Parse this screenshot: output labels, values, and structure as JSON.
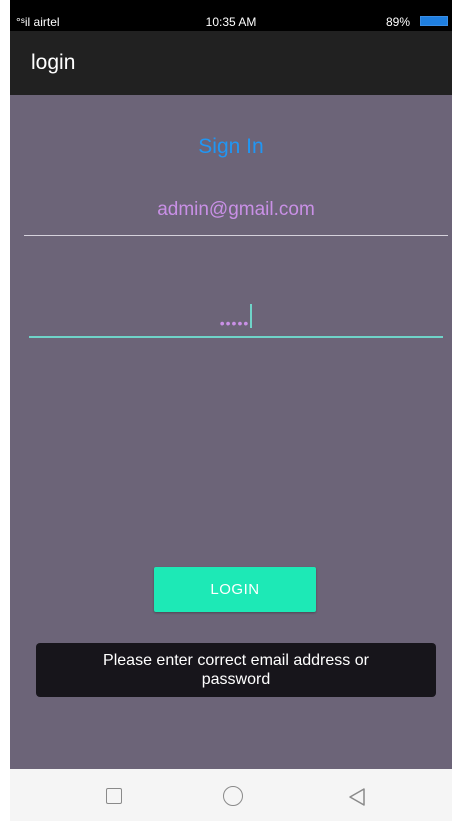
{
  "status_bar": {
    "carrier": "°ˢil airtel",
    "time": "10:35 AM",
    "battery": "89%"
  },
  "app_bar": {
    "title": "login"
  },
  "form": {
    "heading": "Sign In",
    "email_value": "admin@gmail.com",
    "password_masked": "•••••",
    "login_label": "LOGIN"
  },
  "toast": {
    "message": "Please enter correct email address or password"
  },
  "nav_bar": {
    "icons": [
      "recent-apps-icon",
      "home-icon",
      "back-icon"
    ]
  },
  "colors": {
    "background": "#6c6478",
    "app_bar": "#212121",
    "accent": "#1de9b6",
    "heading": "#2196f3",
    "field_text": "#c990e6"
  }
}
